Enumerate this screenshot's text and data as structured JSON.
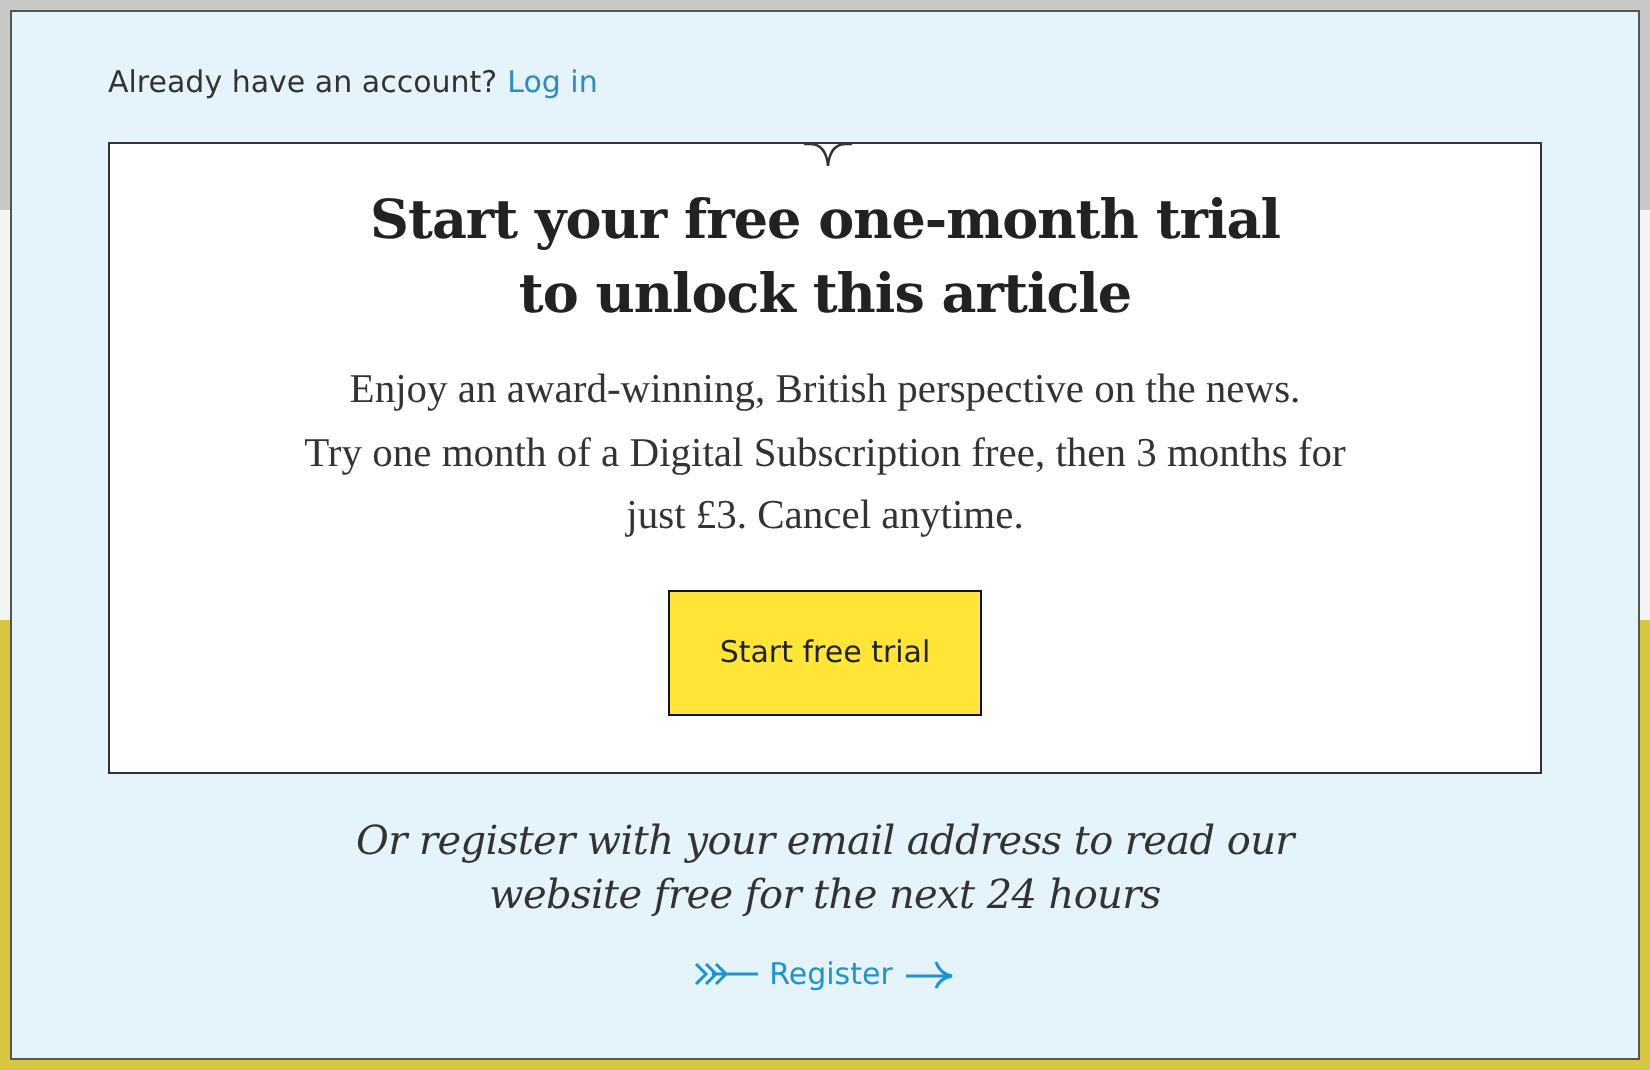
{
  "login_prompt": {
    "text": "Already have an account?",
    "link": "Log in"
  },
  "offer_card": {
    "title_lines": [
      "Start your free one-month trial",
      "to unlock this article"
    ],
    "body_lines": [
      "Enjoy an award-winning, British perspective on the news.",
      "Try one month of a Digital Subscription free, then 3 months for",
      "just £3. Cancel anytime."
    ],
    "button": "Start free trial"
  },
  "register_prompt": [
    "Or register with your email address to read our",
    "website free for the next 24 hours"
  ],
  "register_link": "Register"
}
